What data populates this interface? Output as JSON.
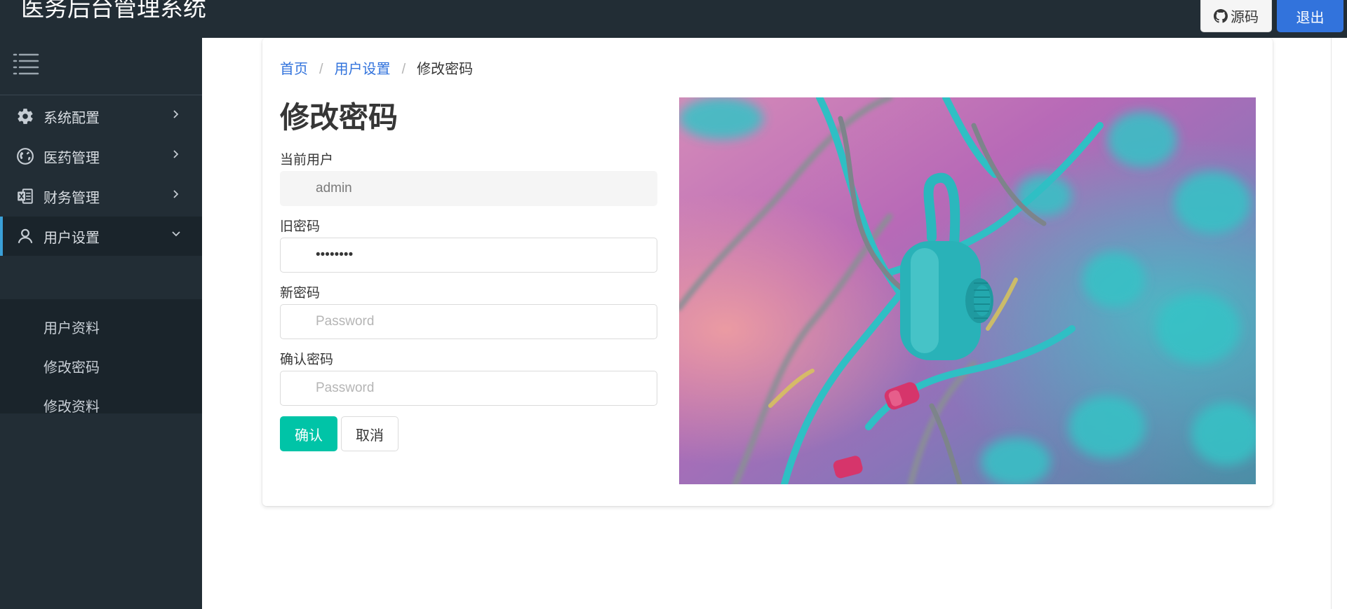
{
  "app": {
    "title": "医务后台管理系统"
  },
  "header": {
    "source_label": "源码",
    "logout_label": "退出"
  },
  "sidebar": {
    "items": [
      {
        "label": "系统配置",
        "icon": "gear-icon"
      },
      {
        "label": "医药管理",
        "icon": "globe-icon"
      },
      {
        "label": "财务管理",
        "icon": "excel-file-icon"
      },
      {
        "label": "用户设置",
        "icon": "user-icon"
      }
    ],
    "submenu": [
      {
        "label": "用户资料"
      },
      {
        "label": "修改密码"
      },
      {
        "label": "修改资料"
      }
    ]
  },
  "breadcrumb": {
    "home": "首页",
    "section": "用户设置",
    "current": "修改密码"
  },
  "form": {
    "title": "修改密码",
    "current_user_label": "当前用户",
    "current_user_value": "admin",
    "old_password_label": "旧密码",
    "old_password_value": "12345678",
    "new_password_label": "新密码",
    "new_password_placeholder": "Password",
    "confirm_password_label": "确认密码",
    "confirm_password_placeholder": "Password",
    "confirm_button": "确认",
    "cancel_button": "取消"
  },
  "colors": {
    "navbar": "#222d35",
    "sidebar": "#222d35",
    "primary": "#3273dc",
    "success": "#00c4a7",
    "lock": "#2bb7bd",
    "photo_background": "#c87aa8"
  }
}
